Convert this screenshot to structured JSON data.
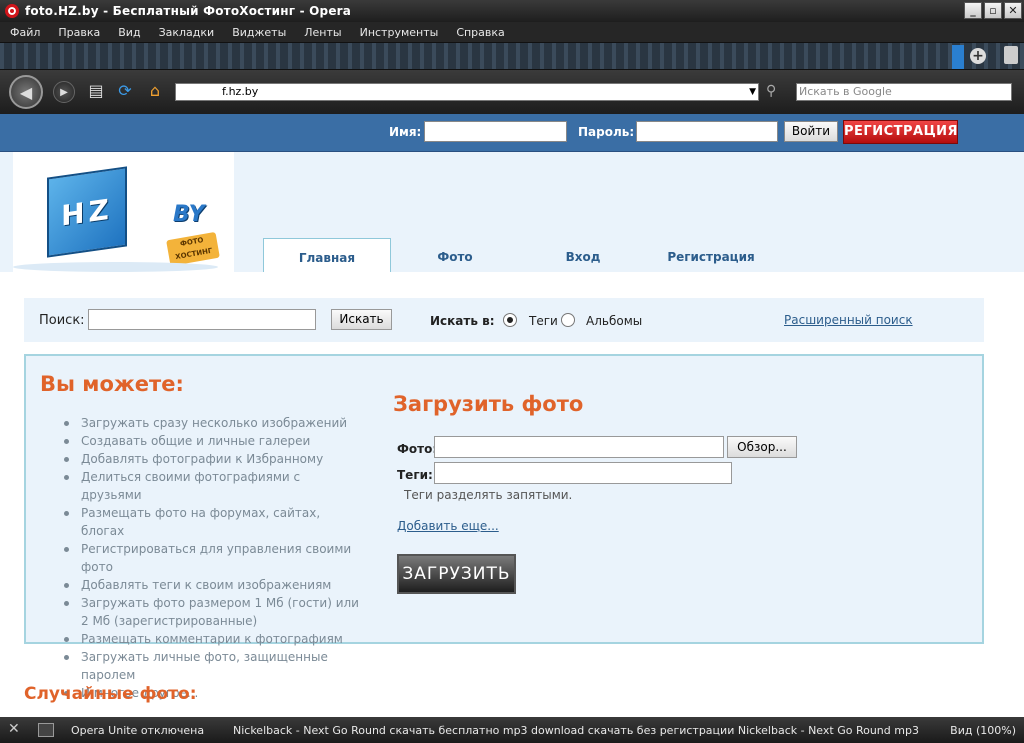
{
  "window": {
    "title": "foto.HZ.by - Бесплатный ФотоХостинг - Opera"
  },
  "menu": [
    "Файл",
    "Правка",
    "Вид",
    "Закладки",
    "Виджеты",
    "Ленты",
    "Инструменты",
    "Справка"
  ],
  "toolbar": {
    "address": "f.hz.by",
    "search_placeholder": "Искать в Google"
  },
  "login": {
    "name_label": "Имя:",
    "password_label": "Пароль:",
    "login_button": "Войти",
    "register_button": "РЕГИСТРАЦИЯ"
  },
  "logo": {
    "mark": "HZ",
    "suffix": "BY",
    "badge": "ФОТО ХОСТИНГ"
  },
  "nav": {
    "tabs": [
      {
        "label": "Главная",
        "active": true
      },
      {
        "label": "Фото",
        "active": false
      },
      {
        "label": "Вход",
        "active": false
      },
      {
        "label": "Регистрация",
        "active": false
      }
    ]
  },
  "search": {
    "label": "Поиск:",
    "button": "Искать",
    "scope_label": "Искать в:",
    "options": [
      {
        "label": "Теги",
        "selected": true
      },
      {
        "label": "Альбомы",
        "selected": false
      }
    ],
    "advanced_link": "Расширенный поиск"
  },
  "features": {
    "title": "Вы можете:",
    "items": [
      "Загружать сразу несколько изображений",
      "Создавать общие и личные галереи",
      "Добавлять фотографии к Избранному",
      "Делиться своими фотографиями с друзьями",
      "Размещать фото на форумах, сайтах, блогах",
      "Регистрироваться для управления своими фото",
      "Добавлять теги к своим изображениям",
      "Загружать фото размером 1 Мб (гости) или 2 Мб (зарегистрированные)",
      "Размещать комментарии к фотографиям",
      "Загружать личные фото, защищенные паролем",
      "И многое другое..."
    ]
  },
  "upload": {
    "title": "Загрузить фото",
    "photo_label": "Фото:",
    "browse_button": "Обзор...",
    "tags_label": "Теги:",
    "tags_hint": "Теги разделять запятыми.",
    "add_more_link": "Добавить еще...",
    "upload_button": "ЗАГРУЗИТЬ"
  },
  "random": {
    "title": "Случайные фото:"
  },
  "statusbar": {
    "unite": "Opera Unite отключена",
    "news": "Nickelback - Next Go Round скачать бесплатно mp3 download скачать без регистрации Nickelback - Next Go Round mp3",
    "zoom": "Вид (100%)"
  }
}
